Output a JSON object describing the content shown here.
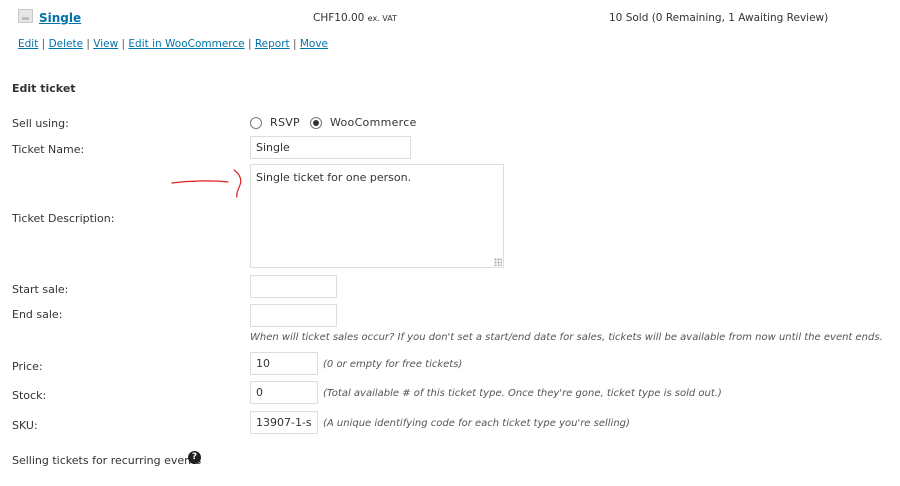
{
  "ticket_row": {
    "name": "Single",
    "price": "CHF10.00",
    "price_suffix": "ex. VAT",
    "sold_text": "10 Sold (0 Remaining, 1 Awaiting Review)",
    "actions": [
      "Edit",
      "Delete",
      "View",
      "Edit in WooCommerce",
      "Report",
      "Move"
    ]
  },
  "edit_ticket": {
    "heading": "Edit ticket",
    "sell_using_label": "Sell using:",
    "sell_options": [
      "RSVP",
      "WooCommerce"
    ],
    "sell_selected": "WooCommerce",
    "ticket_name_label": "Ticket Name:",
    "ticket_name_value": "Single",
    "ticket_description_label": "Ticket Description:",
    "ticket_description_value": "Single ticket for one person.",
    "start_sale_label": "Start sale:",
    "end_sale_label": "End sale:",
    "sale_hint": "When will ticket sales occur? If you don't set a start/end date for sales, tickets will be available from now until the event ends.",
    "price_label": "Price:",
    "price_value": "10",
    "price_hint": "(0 or empty for free tickets)",
    "stock_label": "Stock:",
    "stock_value": "0",
    "stock_hint": "(Total available # of this ticket type. Once they're gone, ticket type is sold out.)",
    "sku_label": "SKU:",
    "sku_value": "13907-1-s",
    "sku_hint": "(A unique identifying code for each ticket type you're selling)",
    "recurring_label": "Selling tickets for recurring events",
    "help_icon_glyph": "?"
  },
  "colors": {
    "link": "#0073aa",
    "annotation": "#e02020"
  }
}
